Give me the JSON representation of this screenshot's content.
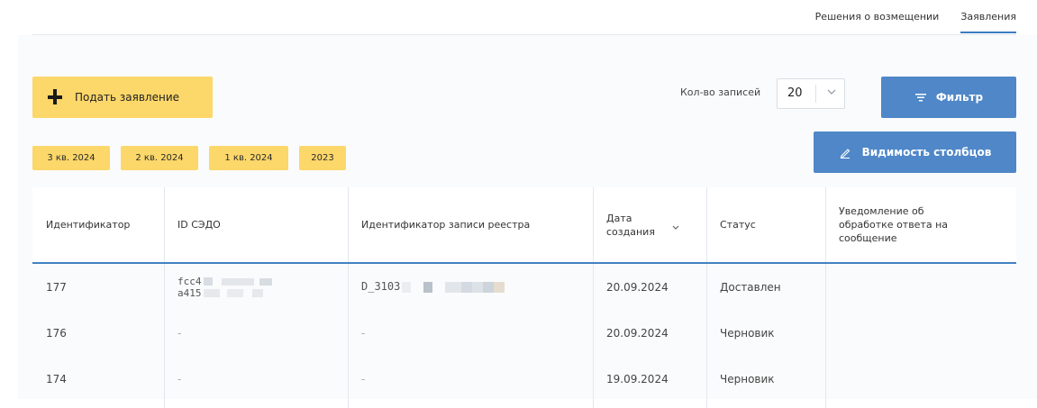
{
  "tabs": [
    {
      "label": "Решения о возмещении",
      "active": false
    },
    {
      "label": "Заявления",
      "active": true
    }
  ],
  "toolbar": {
    "submit_label": "Подать заявление",
    "records_label": "Кол-во записей",
    "records_value": "20",
    "filter_label": "Фильтр",
    "columns_label": "Видимость столбцов"
  },
  "periods": [
    "3 кв. 2024",
    "2 кв. 2024",
    "1 кв. 2024",
    "2023"
  ],
  "table": {
    "headers": {
      "id": "Идентификатор",
      "sedo": "ID СЭДО",
      "registry": "Идентификатор записи реестра",
      "created_line1": "Дата",
      "created_line2": "создания",
      "status": "Статус",
      "notice": "Уведомление об обработке ответа на сообщение"
    },
    "rows": [
      {
        "id": "177",
        "sedo_line1": "fcc4",
        "sedo_line2": "a415",
        "registry": "D_3103",
        "created": "20.09.2024",
        "status": "Доставлен",
        "notice": ""
      },
      {
        "id": "176",
        "sedo": "-",
        "registry": "-",
        "created": "20.09.2024",
        "status": "Черновик",
        "notice": ""
      },
      {
        "id": "174",
        "sedo": "-",
        "registry": "-",
        "created": "19.09.2024",
        "status": "Черновик",
        "notice": ""
      }
    ]
  },
  "colors": {
    "accent": "#4f87c8",
    "yellow": "#fcd769",
    "underline": "#4381c1"
  },
  "icons": [
    "plus-icon",
    "chevron-down-icon",
    "filter-icon",
    "pencil-icon",
    "sort-chevron-icon"
  ]
}
